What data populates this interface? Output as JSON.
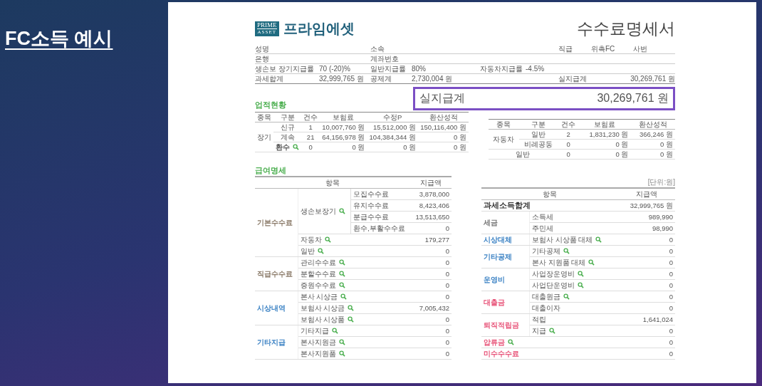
{
  "slide_title": "FC소득 예시",
  "brand": {
    "logo_top": "PRIME",
    "logo_bottom": "ASSET",
    "name": "프라임에셋"
  },
  "doc_title": "수수료명세서",
  "info": {
    "name_label": "성명",
    "affiliation_label": "소속",
    "rank_label": "직급",
    "rank": "위촉FC",
    "employee_no_label": "사번",
    "bank_label": "은행",
    "account_label": "계좌번호",
    "rates": [
      {
        "label": "생손보 장기지급률",
        "value": "70 (-20)%"
      },
      {
        "label": "일반지급률",
        "value": "80%"
      },
      {
        "label": "자동차지급률",
        "value": "-4.5%"
      }
    ],
    "totals": [
      {
        "label": "과세합계",
        "value": "32,999,765 원"
      },
      {
        "label": "공제계",
        "value": "2,730,004 원"
      },
      {
        "label": "실지급계",
        "value": "30,269,761 원"
      }
    ]
  },
  "performance_title": "업적현황",
  "highlight": {
    "label": "실지급계",
    "value": "30,269,761 원"
  },
  "perf_left": {
    "columns": [
      "종목",
      "구분",
      "건수",
      "보험료",
      "수정P",
      "환산성적"
    ],
    "groups": [
      {
        "label": "장기",
        "rows": [
          {
            "label": "신규",
            "search": false,
            "cells": [
              "1",
              "10,007,760 원",
              "15,512,000 원",
              "150,116,400 원"
            ]
          },
          {
            "label": "계속",
            "search": false,
            "cells": [
              "21",
              "64,156,978 원",
              "104,384,344 원",
              "0 원"
            ]
          },
          {
            "label": "환수",
            "search": true,
            "cells": [
              "0",
              "0 원",
              "0 원",
              "0 원"
            ]
          }
        ]
      }
    ]
  },
  "perf_right": {
    "columns": [
      "종목",
      "구분",
      "건수",
      "보험료",
      "환산성적"
    ],
    "groups": [
      {
        "label": "자동차",
        "rows": [
          {
            "label": "일반",
            "cells": [
              "2",
              "1,831,230 원",
              "366,246 원"
            ]
          },
          {
            "label": "비례공동",
            "cells": [
              "0",
              "0 원",
              "0 원"
            ]
          }
        ]
      },
      {
        "label": "일반",
        "cells": [
          "0",
          "0 원",
          "0 원"
        ]
      }
    ]
  },
  "salary_title": "급여명세",
  "unit_note": "[단위:원]",
  "salary_left": {
    "columns": [
      "항목",
      "지급액"
    ],
    "groups": [
      {
        "label": "기본수수료",
        "color": "#8a7a68",
        "items": [
          {
            "label": "생손보장기",
            "search": true,
            "children": [
              {
                "label": "모집수수료",
                "amount": "3,878,000"
              },
              {
                "label": "유지수수료",
                "amount": "8,423,406"
              },
              {
                "label": "분급수수료",
                "amount": "13,513,650"
              },
              {
                "label": "환수,부활수수료",
                "amount": "0"
              }
            ]
          },
          {
            "label": "자동차",
            "search": true,
            "amount": "179,277"
          },
          {
            "label": "일반",
            "search": true,
            "amount": "0"
          }
        ]
      },
      {
        "label": "직급수수료",
        "color": "#8a7a68",
        "items": [
          {
            "label": "관리수수료",
            "search": true,
            "amount": "0"
          },
          {
            "label": "분할수수료",
            "search": true,
            "amount": "0"
          },
          {
            "label": "증원수수료",
            "search": true,
            "amount": "0"
          }
        ]
      },
      {
        "label": "시상내역",
        "color": "#3b82c4",
        "items": [
          {
            "label": "본사 시상금",
            "search": true,
            "amount": "0"
          },
          {
            "label": "보험사 시상금",
            "search": true,
            "amount": "7,005,432"
          },
          {
            "label": "보험사 시상품",
            "search": true,
            "amount": "0"
          }
        ]
      },
      {
        "label": "기타지급",
        "color": "#3b82c4",
        "items": [
          {
            "label": "기타지급",
            "search": true,
            "amount": "0"
          },
          {
            "label": "본사지원금",
            "search": true,
            "amount": "0"
          },
          {
            "label": "본사지원품",
            "search": true,
            "amount": "0"
          }
        ]
      }
    ]
  },
  "salary_right": {
    "columns": [
      "항목",
      "지급액"
    ],
    "groups": [
      {
        "kind": "total",
        "label": "과세소득합계",
        "color": "#333333",
        "search": false,
        "amount": "32,999,765 원"
      },
      {
        "kind": "category",
        "label": "세금",
        "color": "#777777",
        "items": [
          {
            "label": "소득세",
            "search": false,
            "amount": "989,990"
          },
          {
            "label": "주민세",
            "search": false,
            "amount": "98,990"
          }
        ]
      },
      {
        "kind": "category",
        "label": "시상대체",
        "color": "#3b82c4",
        "items": [
          {
            "label": "보험사 시상품 대체",
            "search": true,
            "amount": "0"
          }
        ]
      },
      {
        "kind": "category",
        "label": "기타공제",
        "color": "#3b82c4",
        "items": [
          {
            "label": "기타공제",
            "search": true,
            "amount": "0"
          },
          {
            "label": "본사 지원품 대체",
            "search": true,
            "amount": "0"
          }
        ]
      },
      {
        "kind": "category",
        "label": "운영비",
        "color": "#3b82c4",
        "items": [
          {
            "label": "사업장운영비",
            "search": true,
            "amount": "0"
          },
          {
            "label": "사업단운영비",
            "search": true,
            "amount": "0"
          }
        ]
      },
      {
        "kind": "category",
        "label": "대출금",
        "color": "#e8557a",
        "items": [
          {
            "label": "대출원금",
            "search": true,
            "amount": "0"
          },
          {
            "label": "대출이자",
            "search": false,
            "amount": "0"
          }
        ]
      },
      {
        "kind": "category",
        "label": "퇴직적립금",
        "color": "#e8557a",
        "items": [
          {
            "label": "적립",
            "search": false,
            "amount": "1,641,024"
          },
          {
            "label": "지급",
            "search": true,
            "amount": "0"
          }
        ]
      },
      {
        "kind": "category",
        "label": "압류금",
        "color": "#e8557a",
        "search": true,
        "amount": "0"
      },
      {
        "kind": "category",
        "label": "미수수수료",
        "color": "#e8557a",
        "search": false,
        "amount": "0"
      }
    ]
  }
}
